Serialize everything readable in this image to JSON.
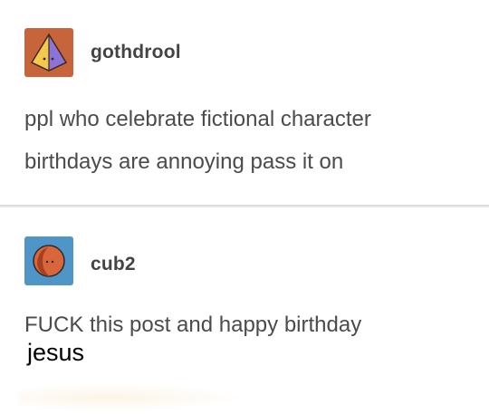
{
  "posts": [
    {
      "username": "gothdrool",
      "avatar_icon": "pyramid-avatar-icon",
      "avatar_colors": {
        "background": "#c8643c",
        "shape": "#f0c040",
        "accent": "#8a6fd0"
      },
      "body_lines": [
        "ppl who celebrate fictional character",
        "birthdays are annoying pass it on"
      ]
    },
    {
      "username": "cub2",
      "avatar_icon": "circle-face-avatar-icon",
      "avatar_colors": {
        "background": "#4f95c8",
        "shape": "#d8663a"
      },
      "body_lines": [
        "FUCK this post and happy birthday"
      ],
      "edited_text": "jesus"
    }
  ]
}
